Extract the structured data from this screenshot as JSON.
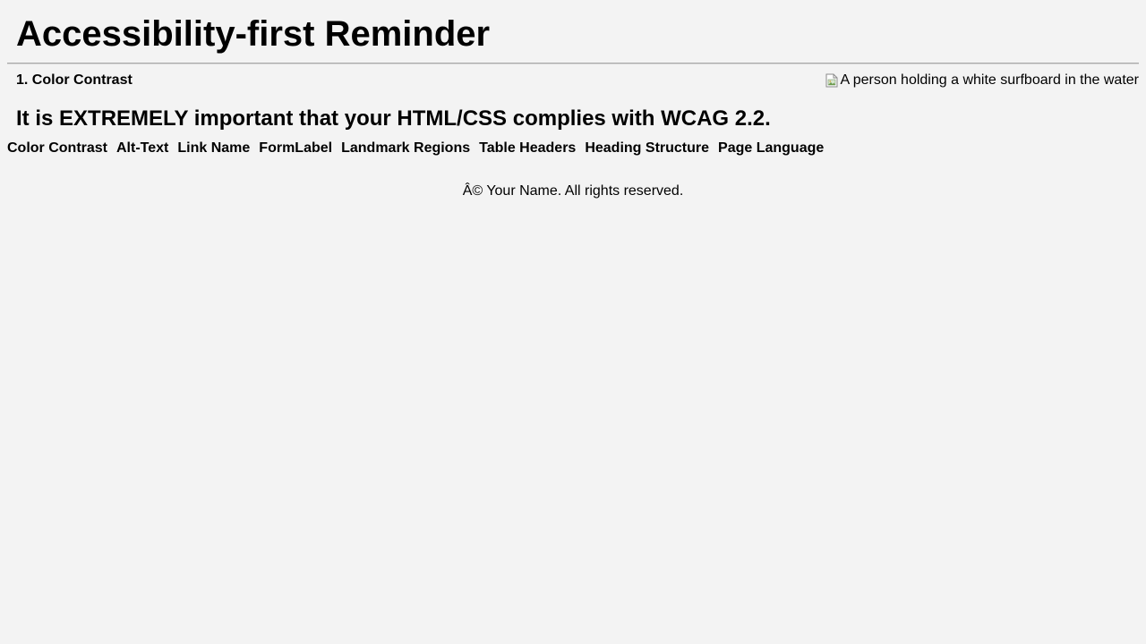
{
  "header": {
    "title": "Accessibility-first Reminder"
  },
  "section": {
    "label": "1. Color Contrast"
  },
  "image": {
    "alt": "A person holding a white surfboard in the water",
    "icon": "broken-image-icon"
  },
  "notice": {
    "text": "It is EXTREMELY important that your HTML/CSS complies with WCAG 2.2."
  },
  "nav": {
    "items": [
      {
        "label": "Color Contrast"
      },
      {
        "label": "Alt-Text"
      },
      {
        "label": "Link Name"
      },
      {
        "label": "FormLabel"
      },
      {
        "label": "Landmark Regions"
      },
      {
        "label": "Table Headers"
      },
      {
        "label": "Heading Structure"
      },
      {
        "label": "Page Language"
      }
    ]
  },
  "footer": {
    "text": "Â© Your Name. All rights reserved."
  },
  "colors": {
    "background": "#f3f3f3",
    "text": "#000000",
    "rule": "#a8a8a8"
  }
}
